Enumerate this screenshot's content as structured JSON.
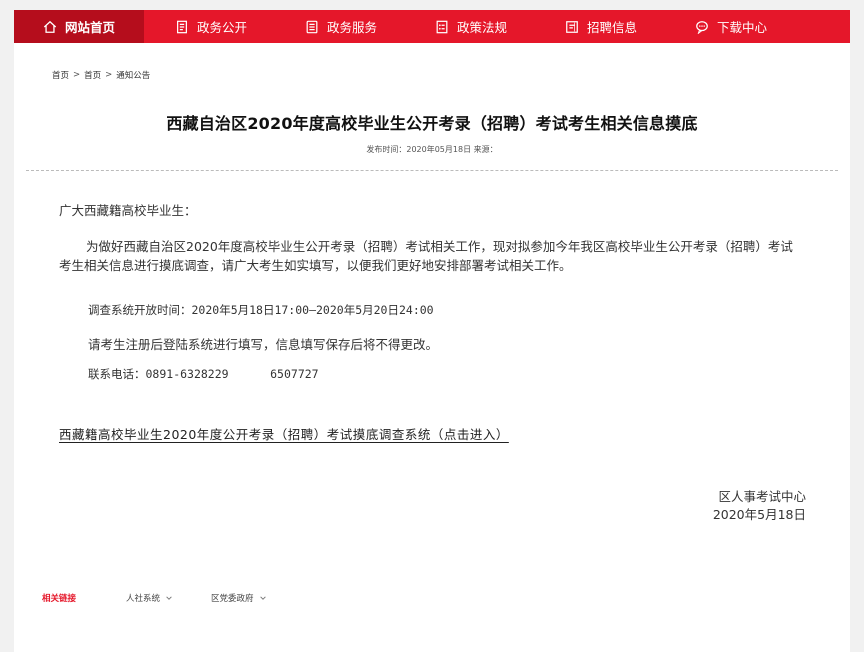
{
  "nav": {
    "items": [
      {
        "label": "网站首页",
        "icon": "home-icon"
      },
      {
        "label": "政务公开",
        "icon": "document-icon"
      },
      {
        "label": "政务服务",
        "icon": "service-icon"
      },
      {
        "label": "政策法规",
        "icon": "policy-icon"
      },
      {
        "label": "招聘信息",
        "icon": "recruit-icon"
      },
      {
        "label": "下载中心",
        "icon": "chat-icon"
      }
    ],
    "active_color": "#b50d1c",
    "bar_color": "#e5172a"
  },
  "breadcrumb": {
    "items": [
      "首页",
      "首页",
      "通知公告"
    ],
    "separator": ">"
  },
  "article": {
    "title": "西藏自治区2020年度高校毕业生公开考录（招聘）考试考生相关信息摸底",
    "meta": "发布时间：2020年05月18日 来源：",
    "greeting": "广大西藏籍高校毕业生：",
    "paragraph": "为做好西藏自治区2020年度高校毕业生公开考录（招聘）考试相关工作，现对拟参加今年我区高校毕业生公开考录（招聘）考试考生相关信息进行摸底调查，请广大考生如实填写，以便我们更好地安排部署考试相关工作。",
    "schedule": "调查系统开放时间：2020年5月18日17:00—2020年5月20日24:00",
    "notice": "请考生注册后登陆系统进行填写，信息填写保存后将不得更改。",
    "phone": "联系电话：0891-6328229      6507727",
    "system_link": "西藏籍高校毕业生2020年度公开考录（招聘）考试摸底调查系统（点击进入）",
    "sign_org": "区人事考试中心",
    "sign_date": "2020年5月18日"
  },
  "footer": {
    "related_label": "相关链接",
    "dropdowns": [
      "人社系统",
      "区党委政府"
    ]
  }
}
